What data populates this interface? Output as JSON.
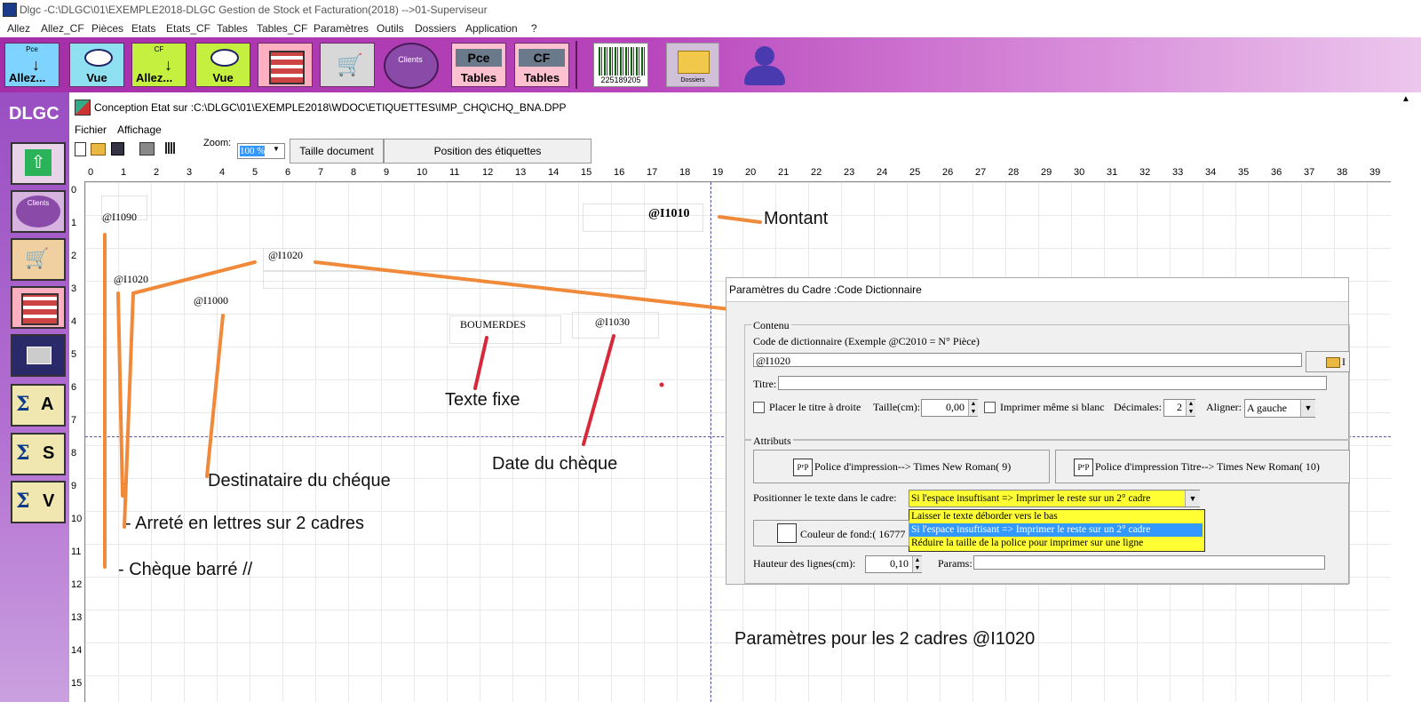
{
  "window": {
    "title": "Dlgc -C:\\DLGC\\01\\EXEMPLE2018-DLGC Gestion de Stock et Facturation(2018) -->01-Superviseur"
  },
  "menubar": [
    "Allez",
    "Allez_CF",
    "Pièces",
    "Etats",
    "Etats_CF",
    "Tables",
    "Tables_CF",
    "Paramètres",
    "Outils",
    "Dossiers",
    "Application",
    "?"
  ],
  "toolbar": {
    "pce_small": "Pce",
    "allez_label": "Allez...",
    "vue_label": "Vue",
    "cf_small": "CF",
    "clients_label": "Clients",
    "pce_tables_top": "Pce",
    "tables_label": "Tables",
    "cf_tables_top": "CF",
    "barcode_number": "225189205",
    "dossiers_label": "Dossiers"
  },
  "left_panel": {
    "brand": "DLGC",
    "clients_label": "Clients",
    "sigma_a": "A",
    "sigma_s": "S",
    "sigma_v": "V",
    "sigma_symbol": "Σ"
  },
  "inner_window": {
    "title": "Conception Etat sur :C:\\DLGC\\01\\EXEMPLE2018\\WDOC\\ETIQUETTES\\IMP_CHQ\\CHQ_BNA.DPP",
    "menu": [
      "Fichier",
      "Affichage"
    ],
    "zoom_label": "Zoom:",
    "zoom_value": "100 %",
    "btn_taille": "Taille document",
    "btn_position": "Position des étiquettes"
  },
  "rulers": {
    "h": [
      "0",
      "1",
      "2",
      "3",
      "4",
      "5",
      "6",
      "7",
      "8",
      "9",
      "10",
      "11",
      "12",
      "13",
      "14",
      "15",
      "16",
      "17",
      "18",
      "19",
      "20",
      "21",
      "22",
      "23",
      "24",
      "25",
      "26",
      "27",
      "28",
      "29",
      "30",
      "31",
      "32",
      "33",
      "34",
      "35",
      "36",
      "37",
      "38",
      "39"
    ],
    "v": [
      "0",
      "1",
      "2",
      "3",
      "4",
      "5",
      "6",
      "7",
      "8",
      "9",
      "10",
      "11",
      "12",
      "13",
      "14",
      "15"
    ]
  },
  "canvas_fields": {
    "i1090": "@I1090",
    "i1010": "@I1010",
    "i1020a": "@I1020",
    "i1020b": "@I1020",
    "i1000": "@I1000",
    "boumerdes": "BOUMERDES",
    "i1030": "@I1030"
  },
  "annotations": {
    "montant": "Montant",
    "texte_fixe": "Texte fixe",
    "date_cheque": "Date du chèque",
    "destinataire": "Destinataire du chéque",
    "arrete": "- Arreté en lettres sur  2 cadres",
    "barre": "- Chèque barré //",
    "dash": "-",
    "params_2_cadres": "Paramètres pour les 2 cadres  @I1020"
  },
  "dialog": {
    "title": "Paramètres du Cadre :Code Dictionnaire",
    "contenu_label": "Contenu",
    "code_label": "Code de dictionnaire (Exemple @C2010 = N° Pièce)",
    "code_value": "@I1020",
    "browse_label": "I",
    "titre_label": "Titre:",
    "titre_value": "",
    "placer_label": "Placer le titre à droite",
    "taille_label": "Taille(cm):",
    "taille_value": "0,00",
    "imprimer_blanc_label": "Imprimer même si blanc",
    "decimales_label": "Décimales:",
    "decimales_value": "2",
    "aligner_label": "Aligner:",
    "aligner_value": "A gauche",
    "attributs_label": "Attributs",
    "police_btn": "Police d'impression--> Times New Roman( 9)",
    "police_titre_btn": "Police d'impression Titre--> Times New Roman( 10)",
    "positionner_label": "Positionner le texte dans le cadre:",
    "positionner_value": "Si l'espace insuftisant => Imprimer le reste sur un 2° cadre",
    "options": [
      "Laisser le texte déborder vers le bas",
      "Si l'espace insuftisant => Imprimer le reste sur un 2° cadre",
      "Réduire la taille de la police pour imprimer sur une ligne"
    ],
    "couleur_btn": "Couleur de fond:( 16777",
    "hauteur_label": "Hauteur des lignes(cm):",
    "hauteur_value": "0,10",
    "params_label": "Params:",
    "params_value": ""
  },
  "colors": {
    "toolbar_purple": "#b845bc",
    "annotation_orange": "#f08a3a",
    "annotation_red": "#d8283c",
    "dropdown_yellow": "#ffff33",
    "dropdown_selected": "#3399ff"
  }
}
